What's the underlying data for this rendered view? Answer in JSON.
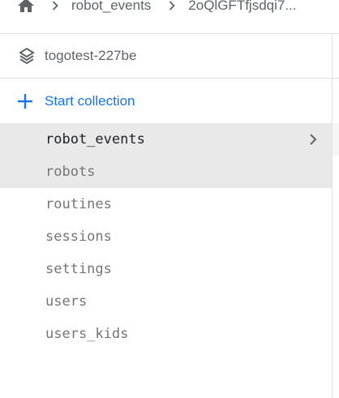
{
  "breadcrumb": {
    "items": [
      "robot_events",
      "2oQlGFTfjsdqi7..."
    ]
  },
  "project": {
    "name": "togotest-227be"
  },
  "actions": {
    "start_collection_label": "Start collection"
  },
  "collections": {
    "items": [
      {
        "label": "robot_events",
        "selected": true
      },
      {
        "label": "robots",
        "selected": false
      },
      {
        "label": "routines",
        "selected": false
      },
      {
        "label": "sessions",
        "selected": false
      },
      {
        "label": "settings",
        "selected": false
      },
      {
        "label": "users",
        "selected": false
      },
      {
        "label": "users_kids",
        "selected": false
      }
    ]
  },
  "colors": {
    "accent": "#1a73e8",
    "selected_bg": "#e9e9e9",
    "muted_text": "#757575"
  },
  "icons": [
    "home-icon",
    "chevron-right-icon",
    "layers-icon",
    "plus-icon"
  ]
}
